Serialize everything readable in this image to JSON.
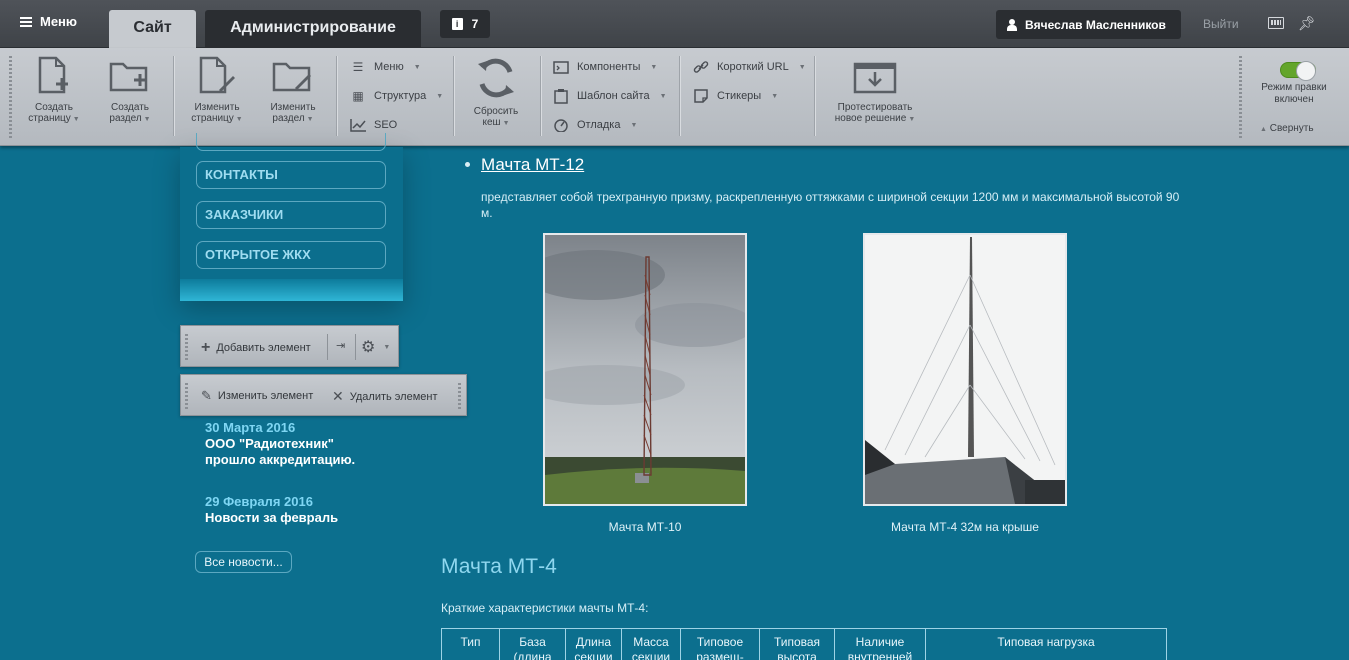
{
  "admin": {
    "menu_label": "Меню",
    "tabs": [
      "Сайт",
      "Администрирование"
    ],
    "notifications_count": "7",
    "user_name": "Вячеслав Масленников",
    "logout_label": "Выйти",
    "toolbar": {
      "create_page": [
        "Создать",
        "страницу"
      ],
      "create_section": [
        "Создать",
        "раздел"
      ],
      "edit_page": [
        "Изменить",
        "страницу"
      ],
      "edit_section": [
        "Изменить",
        "раздел"
      ],
      "menu": "Меню",
      "structure": "Структура",
      "seo": "SEO",
      "clear_cache": [
        "Сбросить",
        "кеш"
      ],
      "components": "Компоненты",
      "site_template": "Шаблон сайта",
      "debug": "Отладка",
      "short_url": "Короткий URL",
      "stickers": "Стикеры",
      "test_solution": [
        "Протестировать",
        "новое решение"
      ],
      "edit_mode": [
        "Режим правки",
        "включен"
      ],
      "collapse": "Свернуть"
    }
  },
  "sidebar": {
    "nav": [
      "КОНТАКТЫ",
      "ЗАКАЗЧИКИ",
      "ОТКРЫТОЕ ЖКХ"
    ],
    "add_element": "Добавить элемент",
    "edit_element": "Изменить элемент",
    "delete_element": "Удалить элемент",
    "news": [
      {
        "date": "30 Марта 2016",
        "title": [
          "ООО \"Радиотехник\"",
          "прошло аккредитацию."
        ]
      },
      {
        "date": "29 Февраля 2016",
        "title": [
          "Новости за февраль"
        ]
      }
    ],
    "all_news": "Все новости..."
  },
  "content": {
    "item_title": "Мачта МТ-12",
    "item_desc": "представляет собой трехгранную призму, раскрепленную оттяжками с шириной секции 1200 мм и максимальной высотой 90 м.",
    "photos": [
      {
        "caption": "Мачта МТ-10"
      },
      {
        "caption": "Мачта МТ-4 32м на крыше"
      }
    ],
    "section_heading": "Мачта МТ-4",
    "intro": "Краткие характеристики мачты МТ-4:",
    "table_headers": [
      [
        "Тип"
      ],
      [
        "База",
        "(длина"
      ],
      [
        "Длина",
        "секции"
      ],
      [
        "Масса",
        "секции"
      ],
      [
        "Типовое",
        "размещ-"
      ],
      [
        "Типовая",
        "высота"
      ],
      [
        "Наличие",
        "внутренней"
      ],
      [
        "Типовая нагрузка"
      ]
    ]
  }
}
